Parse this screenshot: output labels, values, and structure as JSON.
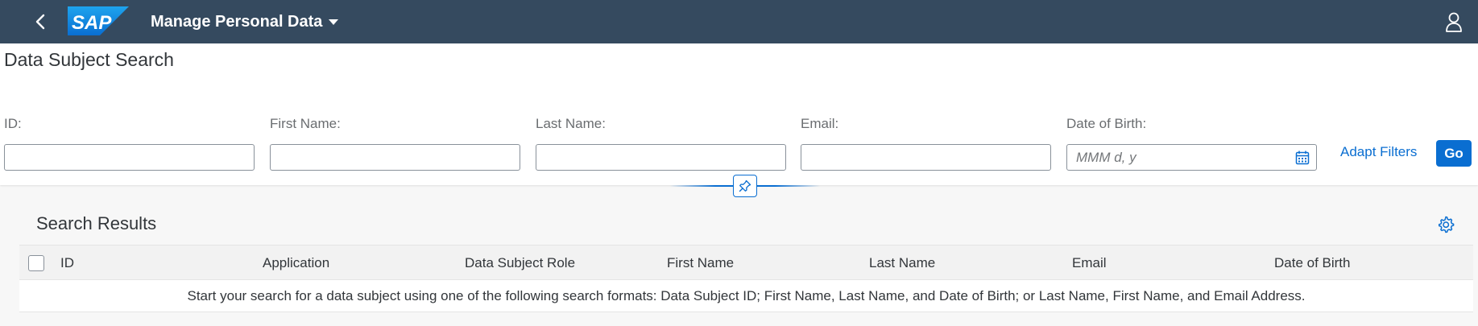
{
  "shell": {
    "logo_text": "SAP",
    "app_title": "Manage Personal Data",
    "back_icon": "chevron-left-icon",
    "user_icon": "person-icon"
  },
  "header": {
    "title": "Data Subject Search"
  },
  "filters": [
    {
      "label": "ID:",
      "value": "",
      "placeholder": ""
    },
    {
      "label": "First Name:",
      "value": "",
      "placeholder": ""
    },
    {
      "label": "Last Name:",
      "value": "",
      "placeholder": ""
    },
    {
      "label": "Email:",
      "value": "",
      "placeholder": ""
    },
    {
      "label": "Date of Birth:",
      "value": "",
      "placeholder": "MMM d, y"
    }
  ],
  "actions": {
    "adapt_filters": "Adapt Filters",
    "go": "Go"
  },
  "results": {
    "title": "Search Results",
    "columns": [
      "ID",
      "Application",
      "Data Subject Role",
      "First Name",
      "Last Name",
      "Email",
      "Date of Birth"
    ],
    "empty_message": "Start your search for a data subject using one of the following search formats: Data Subject ID; First Name, Last Name, and Date of Birth; or Last Name, First Name, and Email Address."
  },
  "colors": {
    "shell": "#354a5f",
    "accent": "#0a6ed1"
  }
}
